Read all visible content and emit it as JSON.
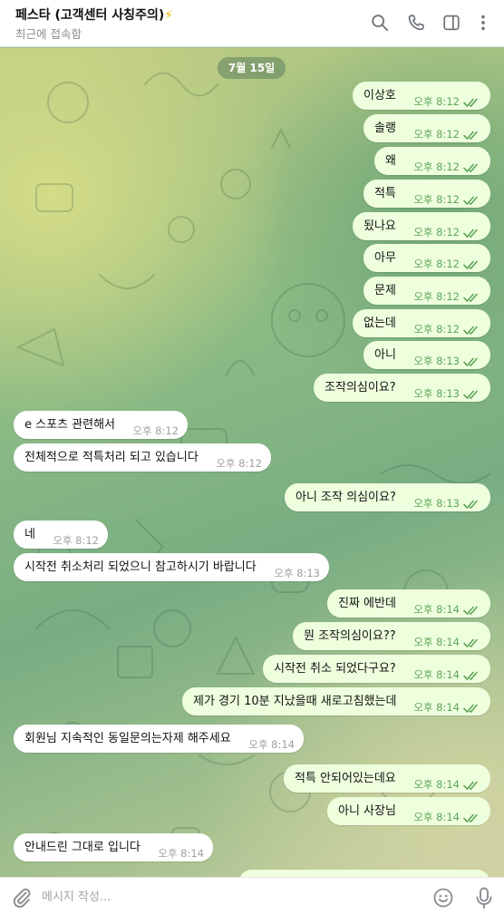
{
  "header": {
    "title": "페스타 (고객센터 사칭주의)",
    "title_emoji": "⚡",
    "status": "최근에 접속함",
    "icons": [
      "search-icon",
      "phone-icon",
      "sidebar-icon",
      "more-vertical-icon"
    ]
  },
  "chat": {
    "date": "7월 15일",
    "messages": [
      {
        "dir": "out",
        "text": "이상호",
        "time": "오후 8:12",
        "read": true
      },
      {
        "dir": "out",
        "text": "솔랭",
        "time": "오후 8:12",
        "read": true
      },
      {
        "dir": "out",
        "text": "왜",
        "time": "오후 8:12",
        "read": true
      },
      {
        "dir": "out",
        "text": "적특",
        "time": "오후 8:12",
        "read": true
      },
      {
        "dir": "out",
        "text": "됬나요",
        "time": "오후 8:12",
        "read": true
      },
      {
        "dir": "out",
        "text": "아무",
        "time": "오후 8:12",
        "read": true
      },
      {
        "dir": "out",
        "text": "문제",
        "time": "오후 8:12",
        "read": true
      },
      {
        "dir": "out",
        "text": "없는데",
        "time": "오후 8:12",
        "read": true
      },
      {
        "dir": "out",
        "text": "아니",
        "time": "오후 8:13",
        "read": true
      },
      {
        "dir": "out",
        "text": "조작의심이요?",
        "time": "오후 8:13",
        "read": true
      },
      {
        "dir": "in",
        "text": "e 스포츠 관련해서",
        "time": "오후 8:12"
      },
      {
        "dir": "in",
        "text": "전체적으로 적특처리 되고 있습니다",
        "time": "오후 8:12"
      },
      {
        "dir": "out",
        "text": "아니 조작 의심이요?",
        "time": "오후 8:13",
        "read": true
      },
      {
        "dir": "in",
        "text": "네",
        "time": "오후 8:12"
      },
      {
        "dir": "in",
        "text": "시작전 취소처리 되었으니 참고하시기 바랍니다",
        "time": "오후 8:13"
      },
      {
        "dir": "out",
        "text": "진짜 에반데",
        "time": "오후 8:14",
        "read": true
      },
      {
        "dir": "out",
        "text": "뭔 조작의심이요??",
        "time": "오후 8:14",
        "read": true
      },
      {
        "dir": "out",
        "text": "시작전 취소 되었다구요?",
        "time": "오후 8:14",
        "read": true
      },
      {
        "dir": "out",
        "text": "제가 경기 10분 지났을때 새로고침했는데",
        "time": "오후 8:14",
        "read": true
      },
      {
        "dir": "in",
        "text": "회원님 지속적인 동일문의는자제 해주세요",
        "time": "오후 8:14"
      },
      {
        "dir": "out",
        "text": "적특 안되어있는데요",
        "time": "오후 8:14",
        "read": true
      },
      {
        "dir": "out",
        "text": "아니 사장님",
        "time": "오후 8:14",
        "read": true
      },
      {
        "dir": "in",
        "text": "안내드린 그대로 입니다",
        "time": "오후 8:14"
      }
    ]
  },
  "composer": {
    "placeholder": "메시지 작성...",
    "icons": [
      "paperclip-icon",
      "emoji-icon",
      "microphone-icon"
    ]
  },
  "colors": {
    "outgoing_bubble": "#eeffde",
    "incoming_bubble": "#ffffff",
    "read_ticks": "#5fa55a",
    "title_bolt": "#f5b400"
  }
}
